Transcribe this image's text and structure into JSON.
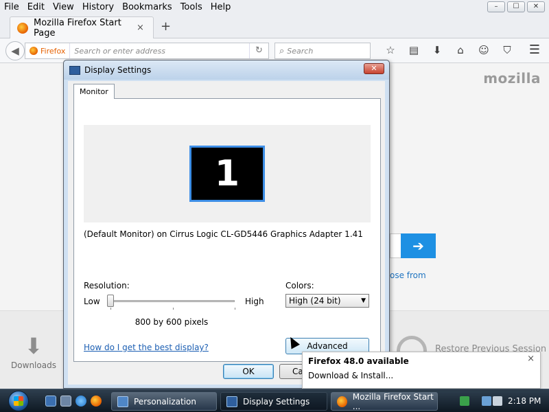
{
  "firefox": {
    "menu": [
      "File",
      "Edit",
      "View",
      "History",
      "Bookmarks",
      "Tools",
      "Help"
    ],
    "window_controls": [
      "–",
      "☐",
      "✕"
    ],
    "tab_title": "Mozilla Firefox Start Page",
    "tab_close": "×",
    "new_tab": "+",
    "identity_label": "Firefox",
    "address_placeholder": "Search or enter address",
    "search_placeholder": "Search",
    "toolbar_icons": [
      "star-icon",
      "reading-list-icon",
      "download-icon",
      "home-icon",
      "hello-icon",
      "pocket-icon",
      "menu-icon"
    ],
    "page": {
      "logo": "mozilla",
      "go_arrow": "➔",
      "choose_from": "ose from",
      "downloads_label": "Downloads",
      "restore_label": "Restore Previous Session"
    }
  },
  "dialog": {
    "title": "Display Settings",
    "close": "✕",
    "tab": "Monitor",
    "monitor_number": "1",
    "monitor_description": "(Default Monitor) on Cirrus Logic CL-GD5446 Graphics Adapter 1.41",
    "resolution_label": "Resolution:",
    "low_label": "Low",
    "high_label": "High",
    "resolution_value": "800 by 600 pixels",
    "resolution_level": 0,
    "colors_label": "Colors:",
    "colors_value": "High (24 bit)",
    "help_link": "How do I get the best display?",
    "advanced_button": "Advanced Settings...",
    "ok_button": "OK",
    "cancel_button": "Canc"
  },
  "notification": {
    "title": "Firefox 48.0 available",
    "subtitle": "Download & Install...",
    "close": "×"
  },
  "taskbar": {
    "tasks": [
      "Personalization",
      "Display Settings",
      "Mozilla Firefox Start ..."
    ],
    "active_task": "Display Settings",
    "clock": "2:18 PM"
  }
}
